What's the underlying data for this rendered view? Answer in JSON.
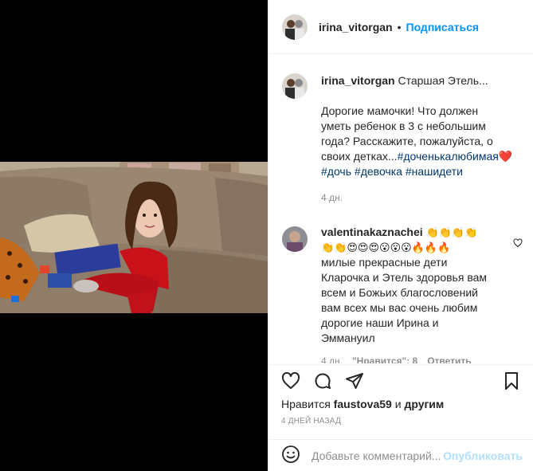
{
  "header": {
    "username": "irina_vitorgan",
    "separator": "•",
    "follow_label": "Подписаться"
  },
  "caption": {
    "username": "irina_vitorgan",
    "title": "Старшая Этель...",
    "line1": "Дорогие мамочки! Что должен",
    "line2": "уметь ребенок в 3 с небольшим",
    "line3": "года? Расскажите, пожалуйста, о",
    "line4_text": "своих детках...",
    "tag1": "#доченькалюбимая",
    "heart_emoji": "❤️",
    "tag2": "#дочь",
    "tag3": "#девочка",
    "tag4": "#нашидети",
    "time": "4 дн."
  },
  "comment": {
    "username": "valentinakaznachei",
    "emoji_line1": "👏👏👏👏",
    "emoji_line2": "👏👏😍😍😍😮😮😮🔥🔥🔥",
    "line1": "милые прекрасные дети",
    "line2": "Кларочка и Этель здоровья вам",
    "line3": "всем и Божьих благословений",
    "line4": "вам всех мы вас очень любим",
    "line5": "дорогие наши Ирина и",
    "line6": "Эммануил",
    "time": "4 дн.",
    "likes": "\"Нравится\": 8",
    "reply": "Ответить"
  },
  "actions": {
    "likes_prefix": "Нравится",
    "likes_user": "faustova59",
    "likes_mid": "и",
    "likes_others": "другим",
    "date": "4 ДНЕЙ НАЗАД"
  },
  "add_comment": {
    "placeholder": "Добавьте комментарий...",
    "post_label": "Опубликовать"
  },
  "colors": {
    "accent": "#0095f6",
    "hashtag": "#00376b",
    "muted": "#8e8e8e",
    "post_disabled": "#b2dffc"
  }
}
